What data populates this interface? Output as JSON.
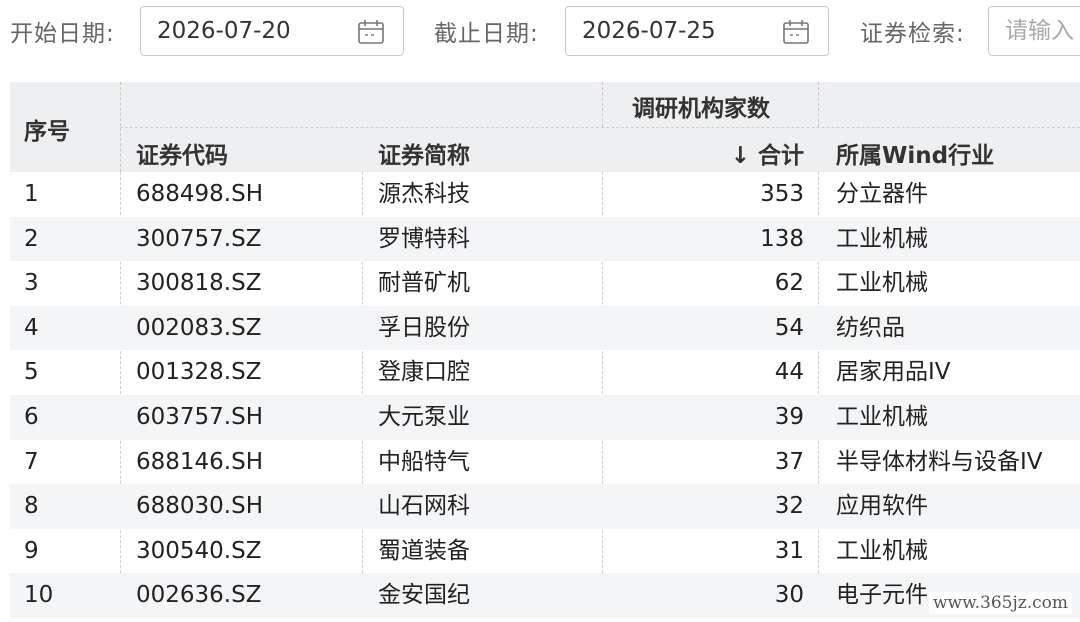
{
  "filters": {
    "start_label": "开始日期:",
    "start_value": "2026-07-20",
    "end_label": "截止日期:",
    "end_value": "2026-07-25",
    "search_label": "证券检索:",
    "search_placeholder": "请输入"
  },
  "table": {
    "group_header": "调研机构家数",
    "headers": {
      "index": "序号",
      "code": "证券代码",
      "name": "证券简称",
      "total": "↓ 合计",
      "industry": "所属Wind行业"
    },
    "rows": [
      {
        "index": "1",
        "code": "688498.SH",
        "name": "源杰科技",
        "total": "353",
        "industry": "分立器件"
      },
      {
        "index": "2",
        "code": "300757.SZ",
        "name": "罗博特科",
        "total": "138",
        "industry": "工业机械"
      },
      {
        "index": "3",
        "code": "300818.SZ",
        "name": "耐普矿机",
        "total": "62",
        "industry": "工业机械"
      },
      {
        "index": "4",
        "code": "002083.SZ",
        "name": "孚日股份",
        "total": "54",
        "industry": "纺织品"
      },
      {
        "index": "5",
        "code": "001328.SZ",
        "name": "登康口腔",
        "total": "44",
        "industry": "居家用品IV"
      },
      {
        "index": "6",
        "code": "603757.SH",
        "name": "大元泵业",
        "total": "39",
        "industry": "工业机械"
      },
      {
        "index": "7",
        "code": "688146.SH",
        "name": "中船特气",
        "total": "37",
        "industry": "半导体材料与设备IV"
      },
      {
        "index": "8",
        "code": "688030.SH",
        "name": "山石网科",
        "total": "32",
        "industry": "应用软件"
      },
      {
        "index": "9",
        "code": "300540.SZ",
        "name": "蜀道装备",
        "total": "31",
        "industry": "工业机械"
      },
      {
        "index": "10",
        "code": "002636.SZ",
        "name": "金安国纪",
        "total": "30",
        "industry": "电子元件"
      }
    ]
  },
  "watermark": "www.365jz.com",
  "icons": {
    "start_calendar": "calendar-icon",
    "end_calendar": "calendar-icon"
  },
  "colors": {
    "header_bg": "#eeeff1",
    "alt_row_bg": "#f4f5f7",
    "label_text": "#666666"
  }
}
